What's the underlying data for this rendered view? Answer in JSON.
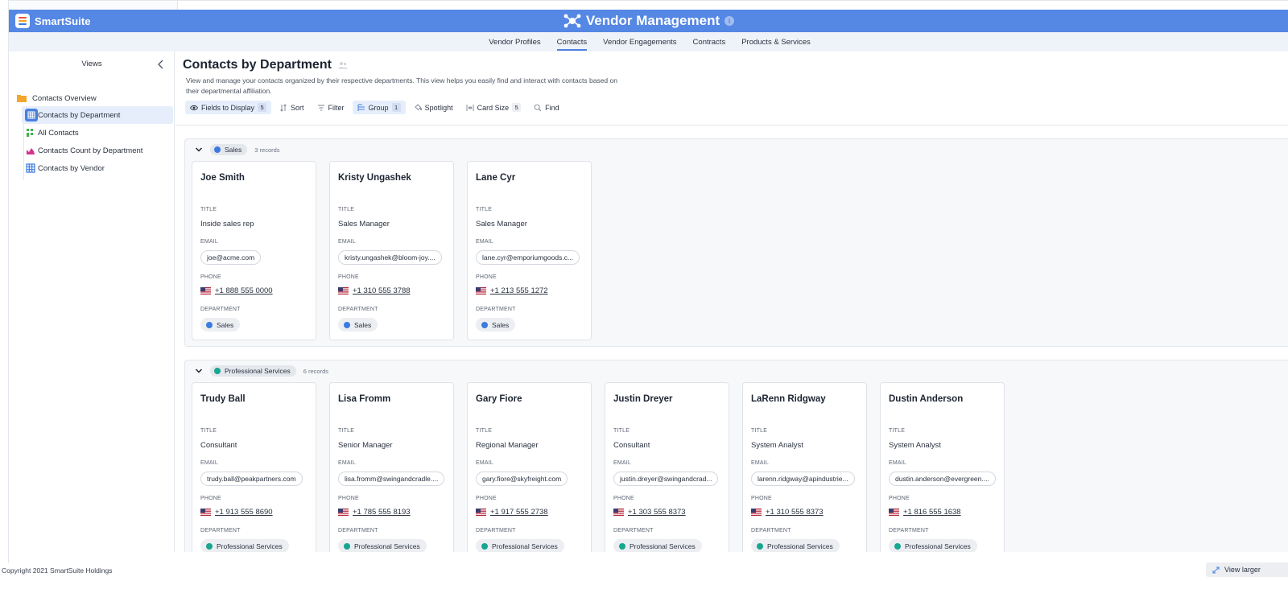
{
  "brand": {
    "name": "SmartSuite"
  },
  "app": {
    "title": "Vendor Management"
  },
  "nav_tabs": [
    {
      "label": "Vendor Profiles"
    },
    {
      "label": "Contacts",
      "active": true
    },
    {
      "label": "Vendor Engagements"
    },
    {
      "label": "Contracts"
    },
    {
      "label": "Products & Services"
    }
  ],
  "sidebar": {
    "heading": "Views",
    "folder": "Contacts Overview",
    "items": [
      {
        "label": "Contacts by Department",
        "icon": "grid-view-icon",
        "active": true
      },
      {
        "label": "All Contacts",
        "icon": "kanban-view-icon"
      },
      {
        "label": "Contacts Count by Department",
        "icon": "chart-view-icon"
      },
      {
        "label": "Contacts by Vendor",
        "icon": "grid-view-icon"
      }
    ]
  },
  "page": {
    "title": "Contacts by Department",
    "description": "View and manage your contacts organized by their respective departments. This view helps you easily find and interact with contacts based on their departmental affiliation."
  },
  "toolbar": {
    "fields_label": "Fields to Display",
    "fields_count": "5",
    "sort_label": "Sort",
    "filter_label": "Filter",
    "group_label": "Group",
    "group_count": "1",
    "spotlight_label": "Spotlight",
    "cardsize_label": "Card Size",
    "cardsize_count": "5",
    "find_label": "Find"
  },
  "field_labels": {
    "title": "TITLE",
    "email": "EMAIL",
    "phone": "PHONE",
    "department": "DEPARTMENT"
  },
  "colors": {
    "sales": "#3b7be0",
    "professional_services": "#17a68f",
    "header": "#5587e4"
  },
  "groups": [
    {
      "name": "Sales",
      "records": "3 records",
      "cards": [
        {
          "name": "Joe Smith",
          "title": "Inside sales rep",
          "email": "joe@acme.com",
          "phone": "+1 888 555 0000",
          "department": "Sales"
        },
        {
          "name": "Kristy Ungashek",
          "title": "Sales Manager",
          "email": "kristy.ungashek@bloom-joy....",
          "phone": "+1 310 555 3788",
          "department": "Sales"
        },
        {
          "name": "Lane Cyr",
          "title": "Sales Manager",
          "email": "lane.cyr@emporiumgoods.c...",
          "phone": "+1 213 555 1272",
          "department": "Sales"
        }
      ]
    },
    {
      "name": "Professional Services",
      "records": "6 records",
      "cards": [
        {
          "name": "Trudy Ball",
          "title": "Consultant",
          "email": "trudy.ball@peakpartners.com",
          "phone": "+1 913 555 8690",
          "department": "Professional Services"
        },
        {
          "name": "Lisa Fromm",
          "title": "Senior Manager",
          "email": "lisa.fromm@swingandcradle....",
          "phone": "+1 785 555 8193",
          "department": "Professional Services"
        },
        {
          "name": "Gary Fiore",
          "title": "Regional Manager",
          "email": "gary.fiore@skyfreight.com",
          "phone": "+1 917 555 2738",
          "department": "Professional Services"
        },
        {
          "name": "Justin Dreyer",
          "title": "Consultant",
          "email": "justin.dreyer@swingandcrad...",
          "phone": "+1 303 555 8373",
          "department": "Professional Services"
        },
        {
          "name": "LaRenn Ridgway",
          "title": "System Analyst",
          "email": "larenn.ridgway@apindustrie...",
          "phone": "+1 310 555 8373",
          "department": "Professional Services"
        },
        {
          "name": "Dustin Anderson",
          "title": "System Analyst",
          "email": "dustin.anderson@evergreen....",
          "phone": "+1 816 555 1638",
          "department": "Professional Services"
        }
      ]
    }
  ],
  "footer": {
    "copyright": "Copyright 2021 SmartSuite Holdings",
    "view_larger": "View larger"
  }
}
